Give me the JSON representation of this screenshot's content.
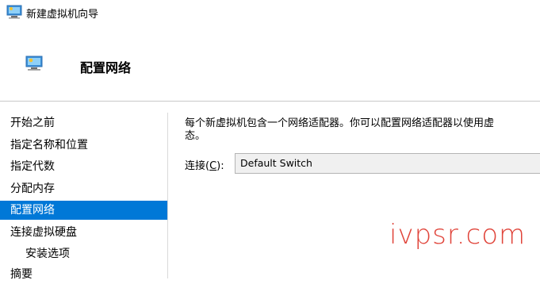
{
  "window": {
    "title": "新建虚拟机向导"
  },
  "header": {
    "title": "配置网络"
  },
  "sidebar": {
    "items": [
      {
        "label": "开始之前",
        "indent": false,
        "active": false
      },
      {
        "label": "指定名称和位置",
        "indent": false,
        "active": false
      },
      {
        "label": "指定代数",
        "indent": false,
        "active": false
      },
      {
        "label": "分配内存",
        "indent": false,
        "active": false
      },
      {
        "label": "配置网络",
        "indent": false,
        "active": true
      },
      {
        "label": "连接虚拟硬盘",
        "indent": false,
        "active": false
      },
      {
        "label": "安装选项",
        "indent": true,
        "active": false
      },
      {
        "label": "摘要",
        "indent": false,
        "active": false
      }
    ]
  },
  "main": {
    "description_line1": "每个新虚拟机包含一个网络适配器。你可以配置网络适配器以使用虚",
    "description_line2": "态。",
    "connection_label_pre": "连接(",
    "connection_label_key": "C",
    "connection_label_post": "):",
    "connection_value": "Default Switch"
  },
  "watermark": {
    "text": "ivpsr.com"
  },
  "colors": {
    "accent": "#0078d7",
    "watermark": "#e0443a"
  },
  "icons": {
    "title": "hyperv-vm-icon",
    "header": "network-config-icon"
  }
}
